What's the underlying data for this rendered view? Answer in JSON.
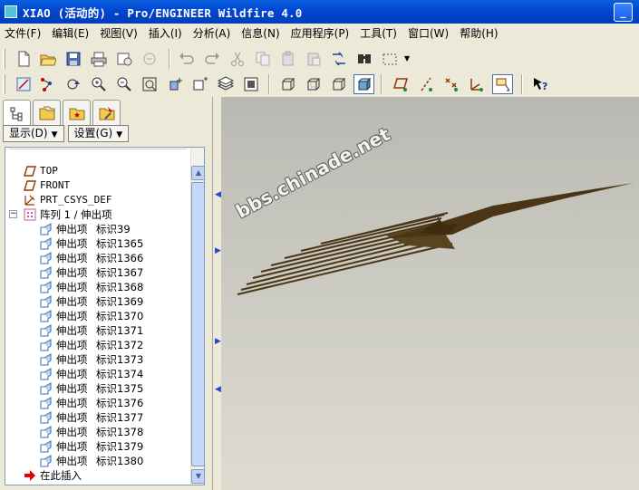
{
  "window": {
    "title": "XIAO (活动的) - Pro/ENGINEER Wildfire 4.0",
    "minimize_label": "_"
  },
  "menubar": {
    "items": [
      {
        "label": "文件(F)"
      },
      {
        "label": "编辑(E)"
      },
      {
        "label": "视图(V)"
      },
      {
        "label": "插入(I)"
      },
      {
        "label": "分析(A)"
      },
      {
        "label": "信息(N)"
      },
      {
        "label": "应用程序(P)"
      },
      {
        "label": "工具(T)"
      },
      {
        "label": "窗口(W)"
      },
      {
        "label": "帮助(H)"
      }
    ]
  },
  "toolbar1": {
    "icons": [
      "new-file-icon",
      "open-folder-icon",
      "save-icon",
      "print-icon",
      "send-icon",
      "send-disabled-icon",
      "undo-icon",
      "redo-icon",
      "cut-icon",
      "copy-icon",
      "paste-icon",
      "paste-special-icon",
      "regenerate-icon",
      "find-icon",
      "select-box-icon"
    ]
  },
  "toolbar2": {
    "icons": [
      "sketch-icon",
      "datum-point-display-icon",
      "spin-icon",
      "zoom-in-icon",
      "zoom-out-icon",
      "refit-icon",
      "reorient-icon",
      "saved-views-icon",
      "layers-icon",
      "view-manager-icon",
      "wireframe-icon",
      "hidden-line-icon",
      "no-hidden-icon",
      "shading-icon",
      "datum-planes-icon",
      "datum-axes-icon",
      "datum-points-icon",
      "coord-sys-icon",
      "annotation-icon",
      "whats-this-icon"
    ]
  },
  "panel": {
    "tabs": [
      "model-tree-tab",
      "folder-browser-tab",
      "favorites-tab",
      "connections-tab"
    ],
    "display_button": "显示(D)",
    "settings_button": "设置(G)"
  },
  "tree": {
    "datum_top": "TOP",
    "datum_front": "FRONT",
    "csys": "PRT_CSYS_DEF",
    "pattern": "阵列 1 / 伸出项",
    "items": [
      {
        "name": "伸出项",
        "id": "标识39"
      },
      {
        "name": "伸出项",
        "id": "标识1365"
      },
      {
        "name": "伸出项",
        "id": "标识1366"
      },
      {
        "name": "伸出项",
        "id": "标识1367"
      },
      {
        "name": "伸出项",
        "id": "标识1368"
      },
      {
        "name": "伸出项",
        "id": "标识1369"
      },
      {
        "name": "伸出项",
        "id": "标识1370"
      },
      {
        "name": "伸出项",
        "id": "标识1371"
      },
      {
        "name": "伸出项",
        "id": "标识1372"
      },
      {
        "name": "伸出项",
        "id": "标识1373"
      },
      {
        "name": "伸出项",
        "id": "标识1374"
      },
      {
        "name": "伸出项",
        "id": "标识1375"
      },
      {
        "name": "伸出项",
        "id": "标识1376"
      },
      {
        "name": "伸出项",
        "id": "标识1377"
      },
      {
        "name": "伸出项",
        "id": "标识1378"
      },
      {
        "name": "伸出项",
        "id": "标识1379"
      },
      {
        "name": "伸出项",
        "id": "标识1380"
      }
    ],
    "insert_here": "在此插入"
  },
  "viewport": {
    "watermark": "bbs.chinade.net"
  },
  "colors": {
    "titlebar": "#0046d0",
    "viewport_top": "#b9b9b3",
    "viewport_bottom": "#dedcd1",
    "model_brown": "#5a4420",
    "insert_arrow": "#e00000"
  }
}
